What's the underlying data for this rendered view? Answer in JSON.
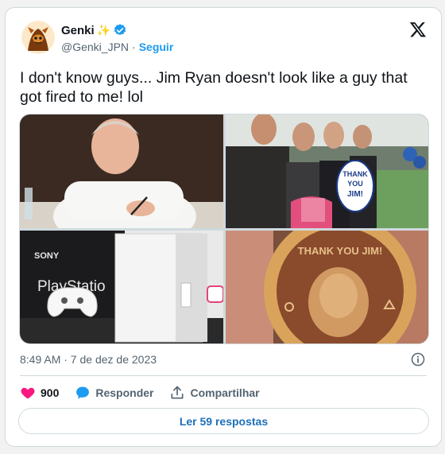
{
  "author": {
    "name": "Genki",
    "sparkle": "✨",
    "handle": "@Genki_JPN",
    "separator": "·",
    "follow_label": "Seguir"
  },
  "tweet": {
    "text": "I don't know guys... Jim Ryan doesn't look like a guy that got fired to me! lol",
    "timestamp": "8:49 AM · 7 de dez de 2023"
  },
  "media": {
    "images": [
      {
        "name": "photo-jim-ryan-signing"
      },
      {
        "name": "photo-party-thank-you-sign",
        "sign_text": [
          "THANK",
          "YOU",
          "JIM!"
        ]
      },
      {
        "name": "photo-playstation-console-controller",
        "brand_text": "SONY",
        "logo_text": "PlayStatio"
      },
      {
        "name": "photo-thank-you-jim-cookie",
        "cookie_text": "THANK YOU JIM!"
      }
    ]
  },
  "actions": {
    "like_count": "900",
    "reply_label": "Responder",
    "share_label": "Compartilhar"
  },
  "replies_button": {
    "label": "Ler 59 respostas"
  },
  "colors": {
    "accent": "#1d9bf0",
    "like": "#f91880",
    "text": "#0f1419",
    "muted": "#536471"
  }
}
